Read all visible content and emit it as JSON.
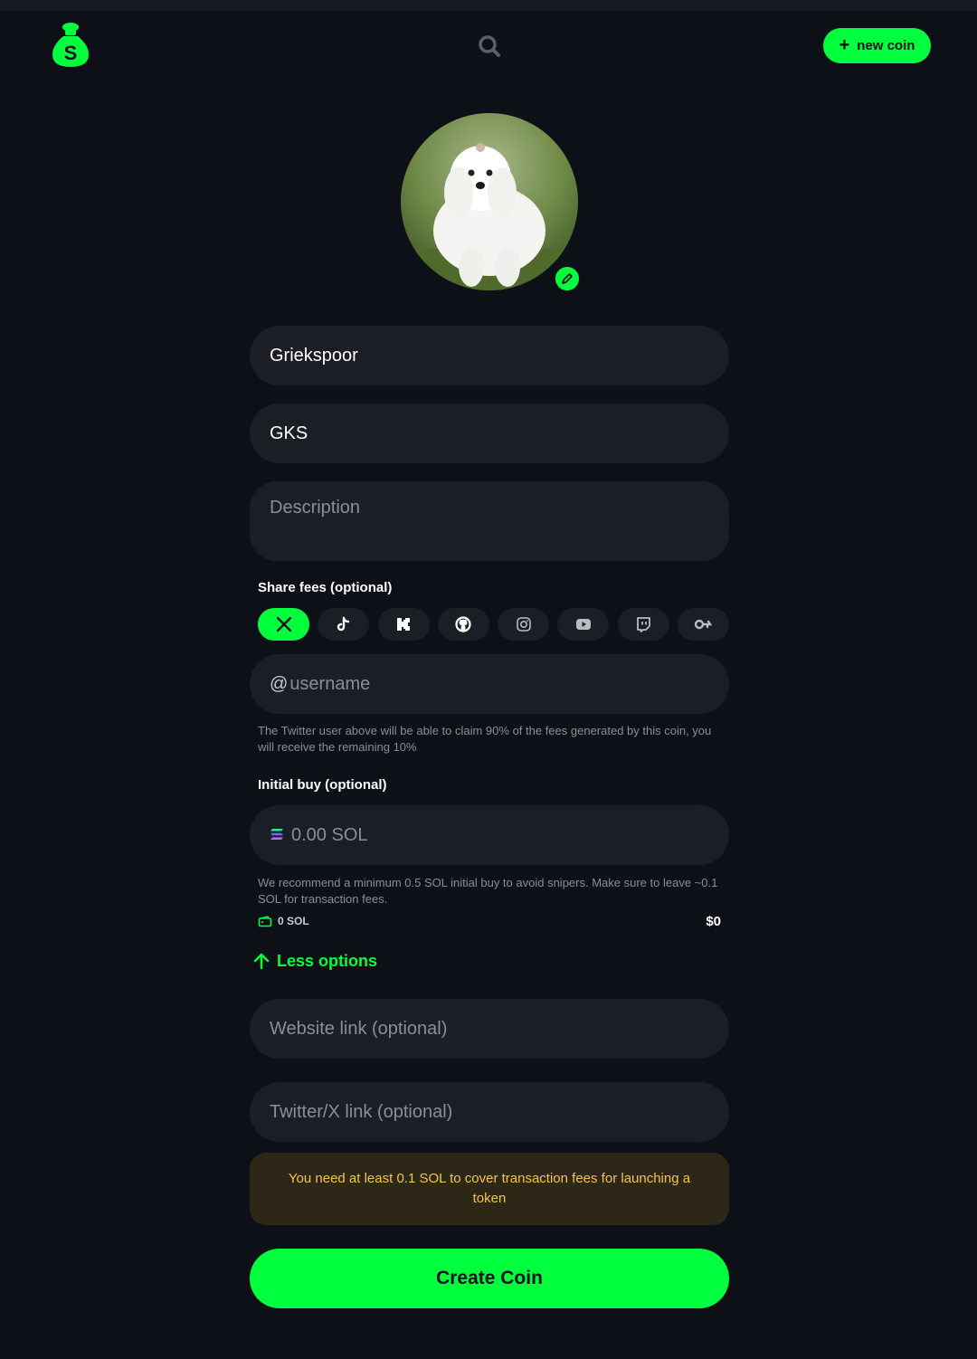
{
  "header": {
    "logo_icon": "money-bag-icon",
    "search_icon": "search-icon",
    "new_coin_label": "new coin"
  },
  "avatar": {
    "image": "white fluffy dog photo",
    "edit_icon": "pencil-icon"
  },
  "form": {
    "name_value": "Griekspoor",
    "ticker_value": "GKS",
    "description_placeholder": "Description",
    "share_fees_label": "Share fees (optional)",
    "social_platforms": [
      {
        "icon": "x-icon",
        "active": true
      },
      {
        "icon": "tiktok-icon",
        "active": false
      },
      {
        "icon": "kick-icon",
        "active": false
      },
      {
        "icon": "github-icon",
        "active": false
      },
      {
        "icon": "instagram-icon",
        "active": false
      },
      {
        "icon": "youtube-icon",
        "active": false
      },
      {
        "icon": "twitch-icon",
        "active": false
      },
      {
        "icon": "key-icon",
        "active": false
      }
    ],
    "username_prefix": "@",
    "username_placeholder": "username",
    "share_fees_help": "The Twitter user above will be able to claim 90% of the fees generated by this coin, you will receive the remaining 10%",
    "initial_buy_label": "Initial buy (optional)",
    "initial_buy_placeholder": "0.00 SOL",
    "initial_buy_help": "We recommend a minimum 0.5 SOL initial buy to avoid snipers. Make sure to leave ~0.1 SOL for transaction fees.",
    "wallet_balance": "0 SOL",
    "usd_value": "$0",
    "less_options_label": "Less options",
    "website_placeholder": "Website link (optional)",
    "twitter_placeholder": "Twitter/X link (optional)"
  },
  "warning": {
    "text": "You need at least 0.1 SOL to cover transaction fees for launching a token"
  },
  "submit": {
    "label": "Create Coin"
  },
  "colors": {
    "background": "#0d1117",
    "field": "#1b1f25",
    "accent": "#00ff3c",
    "warning_text": "#f5c542",
    "warning_bg": "#2c2716"
  }
}
